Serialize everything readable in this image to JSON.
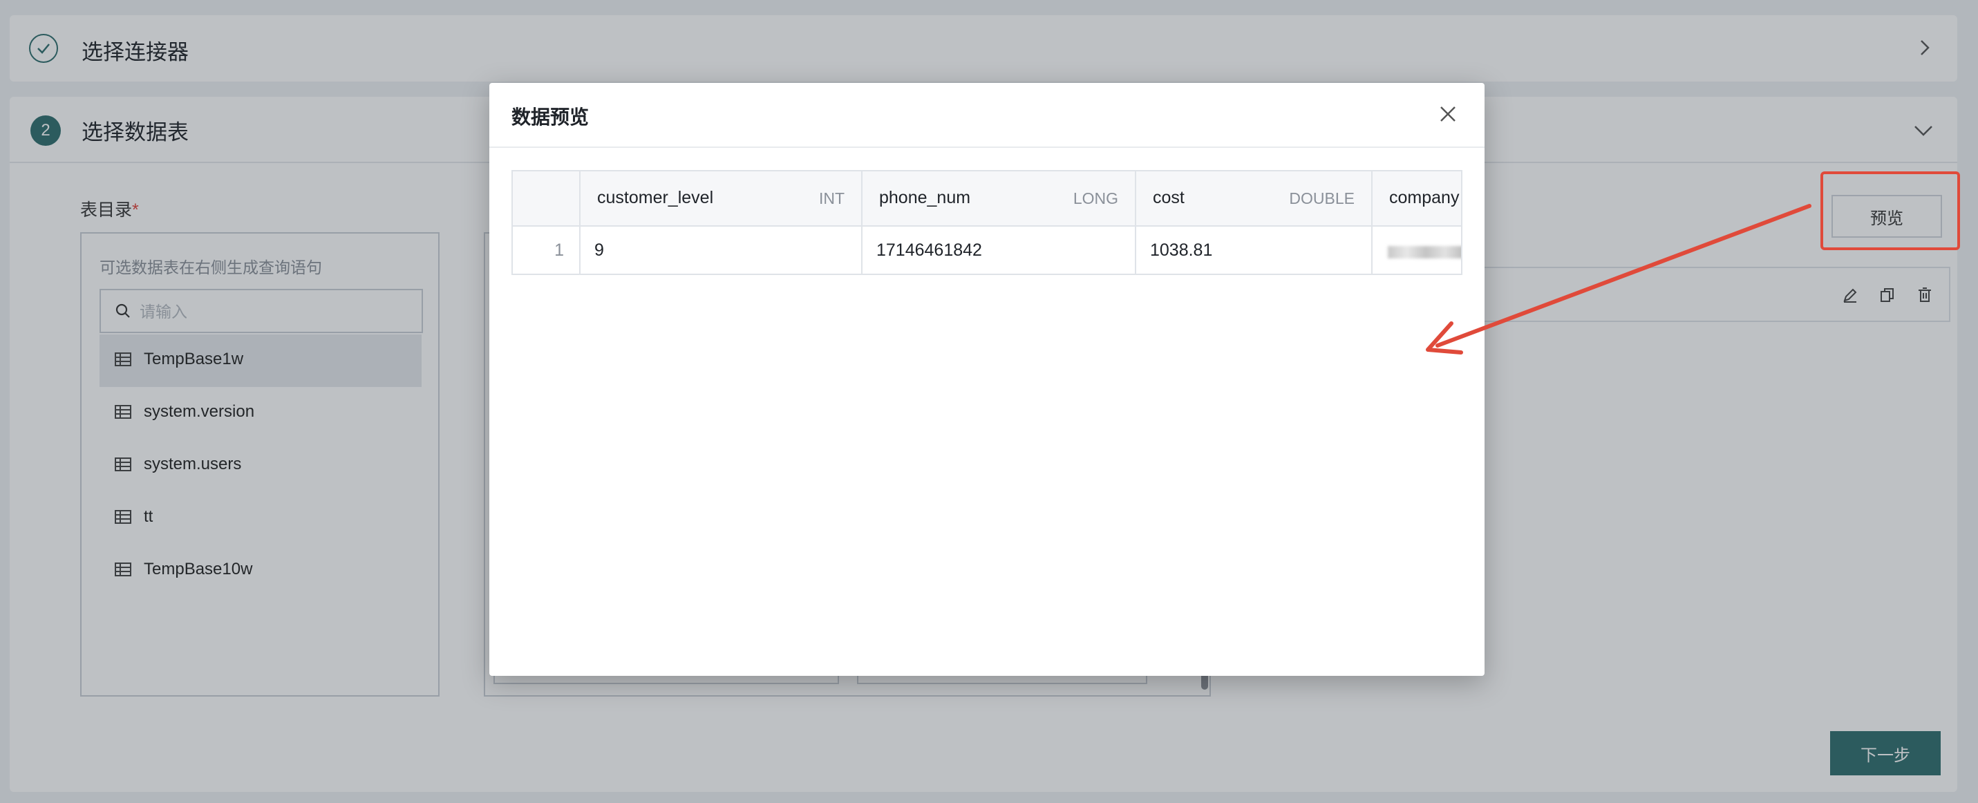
{
  "steps": {
    "step1": {
      "title": "选择连接器",
      "state": "done"
    },
    "step2": {
      "number": "2",
      "title": "选择数据表"
    }
  },
  "left": {
    "label": "表目录",
    "required_mark": "*",
    "hint": "可选数据表在右侧生成查询语句",
    "search_placeholder": "请输入",
    "tables": [
      {
        "name": "TempBase1w",
        "active": true
      },
      {
        "name": "system.version"
      },
      {
        "name": "system.users"
      },
      {
        "name": "tt"
      },
      {
        "name": "TempBase10w"
      }
    ]
  },
  "buttons": {
    "preview": "预览",
    "next": "下一步"
  },
  "modal": {
    "title": "数据预览",
    "columns": [
      {
        "name": "customer_level",
        "type": "INT"
      },
      {
        "name": "phone_num",
        "type": "LONG"
      },
      {
        "name": "cost",
        "type": "DOUBLE"
      },
      {
        "name": "company",
        "type": ""
      }
    ],
    "rows": [
      {
        "index": "1",
        "cells": [
          "9",
          "17146461842",
          "1038.81",
          ""
        ]
      }
    ]
  },
  "colors": {
    "primary": "#2f6e6e",
    "annotation_red": "#e04a3a"
  }
}
